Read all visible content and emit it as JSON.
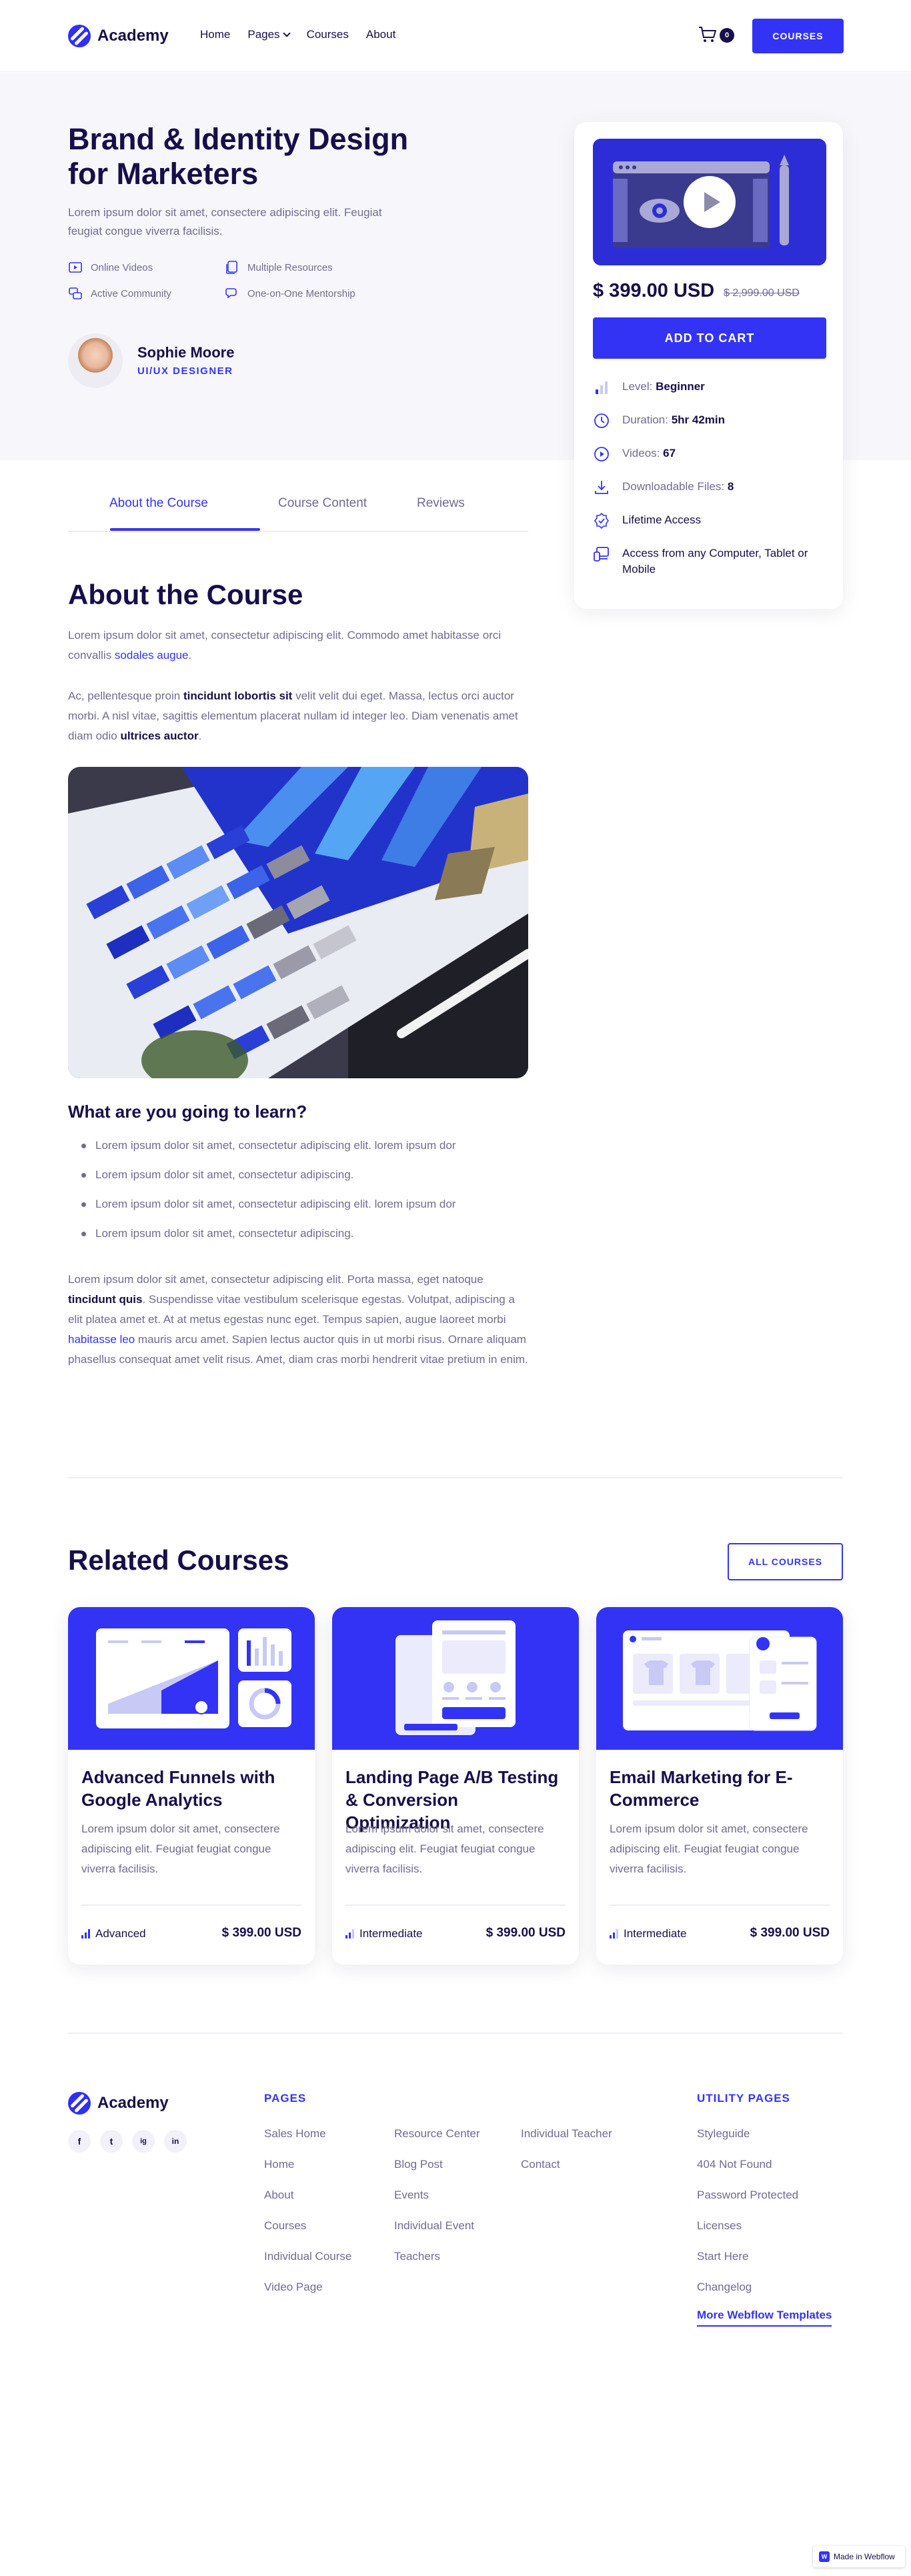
{
  "brand": {
    "name": "Academy",
    "accent": "#3333f6",
    "dark": "#170f49",
    "muted": "#6f6c90"
  },
  "nav": {
    "home": "Home",
    "pages": "Pages",
    "courses": "Courses",
    "about": "About",
    "cart_count": "0",
    "courses_button": "COURSES"
  },
  "hero": {
    "title": "Brand & Identity Design for Marketers",
    "description": "Lorem ipsum dolor sit amet, consectere adipiscing elit. Feugiat feugiat congue viverra facilisis.",
    "features": [
      "Online Videos",
      "Multiple Resources",
      "Active Community",
      "One-on-One Mentorship"
    ],
    "author_name": "Sophie Moore",
    "author_role": "UI/UX DESIGNER"
  },
  "sidebar": {
    "price": "$ 399.00 USD",
    "old_price": "$ 2,999.00 USD",
    "add_to_cart": "ADD TO CART",
    "level_label": "Level:",
    "level_value": "Beginner",
    "duration_label": "Duration:",
    "duration_value": "5hr 42min",
    "videos_label": "Videos:",
    "videos_value": "67",
    "files_label": "Downloadable Files:",
    "files_value": "8",
    "lifetime": "Lifetime Access",
    "access": "Access from any Computer, Tablet or Mobile"
  },
  "tabs": [
    "About the Course",
    "Course Content",
    "Reviews"
  ],
  "about": {
    "title": "About the Course",
    "p1_text": "Lorem ipsum dolor sit amet, consectetur adipiscing elit. Commodo amet habitasse orci convallis ",
    "p1_link": "sodales augue",
    "p1_end": ".",
    "p2_a": "Ac, pellentesque proin ",
    "p2_b": "tincidunt lobortis sit",
    "p2_c": " velit velit dui eget. Massa, lectus orci auctor morbi. A nisl vitae, sagittis elementum placerat nullam id integer leo. Diam venenatis amet diam odio ",
    "p2_d": "ultrices auctor",
    "p2_e": ".",
    "learn_title": "What are you going to learn?",
    "learn_items": [
      "Lorem ipsum dolor sit amet, consectetur adipiscing elit. lorem ipsum dor",
      "Lorem ipsum dolor sit amet, consectetur adipiscing.",
      "Lorem ipsum dolor sit amet, consectetur adipiscing elit. lorem ipsum dor",
      "Lorem ipsum dolor sit amet, consectetur adipiscing."
    ],
    "p3_a": "Lorem ipsum dolor sit amet, consectetur adipiscing elit. Porta massa, eget natoque ",
    "p3_b": "tincidunt quis",
    "p3_c": ". Suspendisse vitae vestibulum scelerisque egestas. Volutpat, adipiscing a elit platea amet et. At at metus egestas nunc eget. Tempus sapien, augue laoreet morbi ",
    "p3_d": "habitasse leo",
    "p3_e": " mauris arcu amet. Sapien lectus auctor quis in ut morbi risus. Ornare aliquam phasellus consequat amet velit risus. Amet, diam cras morbi hendrerit vitae pretium in enim."
  },
  "related": {
    "title": "Related Courses",
    "all_button": "ALL COURSES",
    "cards": [
      {
        "title": "Advanced Funnels with Google Analytics",
        "desc": "Lorem ipsum dolor sit amet, consectere adipiscing elit. Feugiat feugiat congue viverra facilisis.",
        "level": "Advanced",
        "price": "$ 399.00 USD"
      },
      {
        "title": "Landing Page A/B Testing & Conversion Optimization",
        "desc": "Lorem ipsum dolor sit amet, consectere adipiscing elit. Feugiat feugiat congue viverra facilisis.",
        "level": "Intermediate",
        "price": "$ 399.00 USD"
      },
      {
        "title": "Email Marketing for E-Commerce",
        "desc": "Lorem ipsum dolor sit amet, consectere adipiscing elit. Feugiat feugiat congue viverra facilisis.",
        "level": "Intermediate",
        "price": "$ 399.00 USD"
      }
    ]
  },
  "footer": {
    "pages_title": "PAGES",
    "col1": [
      "Sales Home",
      "Home",
      "About",
      "Courses",
      "Individual Course",
      "Video Page"
    ],
    "col2": [
      "Resource Center",
      "Blog Post",
      "Events",
      "Individual Event",
      "Teachers"
    ],
    "col3": [
      "Individual Teacher",
      "Contact"
    ],
    "utility_title": "UTILITY PAGES",
    "utility": [
      "Styleguide",
      "404 Not Found",
      "Password Protected",
      "Licenses",
      "Start Here",
      "Changelog"
    ],
    "more_templates": "More Webflow Templates",
    "social": [
      "f",
      "t",
      "ig",
      "in"
    ],
    "webflow_badge": "Made in Webflow"
  }
}
